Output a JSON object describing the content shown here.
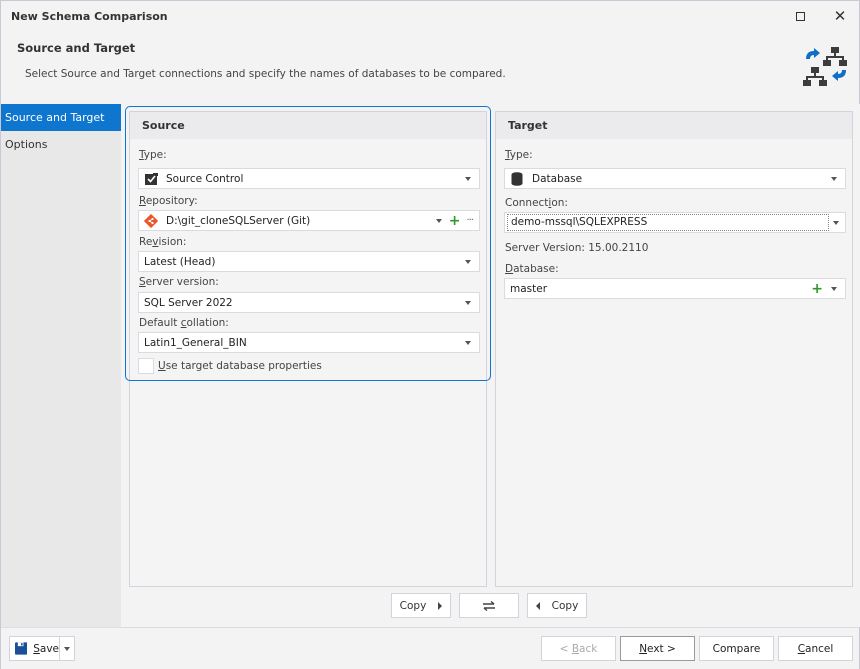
{
  "window": {
    "title": "New Schema Comparison",
    "maximize_icon": "maximize-icon",
    "close_icon": "close-icon"
  },
  "header": {
    "title": "Source and Target",
    "description": "Select Source and Target connections and specify the names of databases to be compared.",
    "icon": "schema-compare-icon",
    "icon_color": "#0f6fc6"
  },
  "sidebar": {
    "items": [
      {
        "label": "Source and Target",
        "active": true
      },
      {
        "label": "Options",
        "active": false
      }
    ],
    "accent": "#0f76d0"
  },
  "source": {
    "title": "Source",
    "type_label": "Type:",
    "type_value": "Source Control",
    "type_icon": "source-control-icon",
    "repository_label": "Repository:",
    "repository_value": "D:\\git_cloneSQLServer (Git)",
    "repository_icon": "git-icon",
    "repository_add_icon": "plus-icon",
    "repository_more_icon": "ellipsis-icon",
    "revision_label": "Revision:",
    "revision_value": "Latest (Head)",
    "server_version_label": "Server version:",
    "server_version_value": "SQL Server 2022",
    "collation_label": "Default collation:",
    "collation_value": "Latin1_General_BIN",
    "use_target_props_label": "Use target database properties",
    "use_target_props_checked": false
  },
  "target": {
    "title": "Target",
    "type_label": "Type:",
    "type_value": "Database",
    "type_icon": "database-icon",
    "connection_label": "Connection:",
    "connection_value": "demo-mssql\\SQLEXPRESS",
    "server_version_text": "Server Version: 15.00.2110",
    "database_label": "Database:",
    "database_value": "master",
    "database_add_icon": "plus-icon"
  },
  "copy_bar": {
    "copy_right_label": "Copy",
    "swap_icon": "swap-icon",
    "copy_left_label": "Copy"
  },
  "footer": {
    "save_label": "Save",
    "save_icon": "floppy-disk-icon",
    "back_label": "< Back",
    "next_label": "Next >",
    "compare_label": "Compare",
    "cancel_label": "Cancel"
  },
  "colors": {
    "accent": "#0f76d0",
    "git_orange": "#e8562a",
    "plus_green": "#2e9a2e",
    "save_blue": "#1a4f9a"
  }
}
